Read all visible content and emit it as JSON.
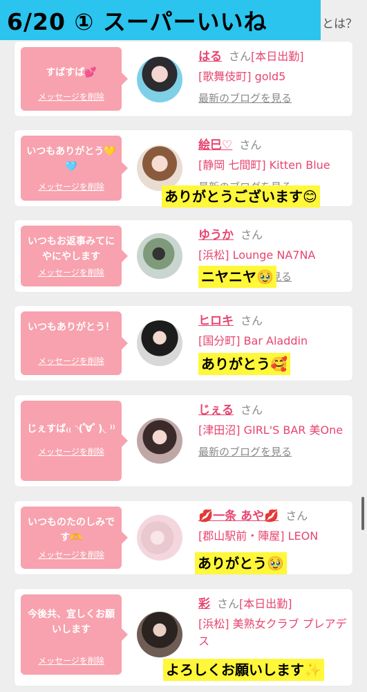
{
  "header": {
    "title": "6/20 ① スーパーいいね",
    "bg_link": "とは？"
  },
  "cards": [
    {
      "message": "すばすば💕",
      "delete": "メッセージを削除",
      "name": "はる",
      "san": "さん",
      "suffix": "[本日出勤]",
      "shop": "[歌舞伎町] gold5",
      "blog": "最新のブログを見る"
    },
    {
      "message": "いつもありがとう💛🩵",
      "delete": "メッセージを削除",
      "name": "絵巳♡",
      "san": "さん",
      "shop": "[静岡 七間町] Kitten Blue",
      "blog": "最新のブログを見る",
      "sticker": "ありがとうございます😊"
    },
    {
      "message": "いつもお返事みてにやにやします",
      "delete": "メッセージを削除",
      "name": "ゆうか",
      "san": "さん",
      "shop": "[浜松] Lounge NA7NA",
      "blog": "最新のブログを見る",
      "sticker": "ニヤニヤ🥹"
    },
    {
      "message": "いつもありがとう！",
      "delete": "メッセージを削除",
      "name": "ヒロキ",
      "san": "さん",
      "shop": "[国分町] Bar Aladdin",
      "sticker": "ありがとう🥰"
    },
    {
      "message": "じぇすば₍₍ ◝( ゚∀ ゚ )◟ ⁾⁾",
      "delete": "メッセージを削除",
      "name": "じぇる",
      "san": "さん",
      "shop": "[津田沼] GIRL'S BAR 美One",
      "blog": "最新のブログを見る"
    },
    {
      "message": "いつものたのしみです🫶",
      "delete": "メッセージを削除",
      "name": "💋一条 あや💋",
      "san": "さん",
      "shop": "[郡山駅前・陣屋] LEON",
      "sticker": "ありがとう🥹"
    },
    {
      "message": "今後共、宜しくお願いします",
      "delete": "メッセージを削除",
      "name": "彩",
      "san": "さん",
      "suffix": "[本日出勤]",
      "shop": "[浜松] 美熟女クラブ プレアデス",
      "sticker": "よろしくお願いします✨"
    }
  ],
  "colors": {
    "accent": "#e7446f",
    "bubble": "#f7a2ae",
    "banner": "#2ac4ee",
    "sticker": "#fff73a"
  }
}
